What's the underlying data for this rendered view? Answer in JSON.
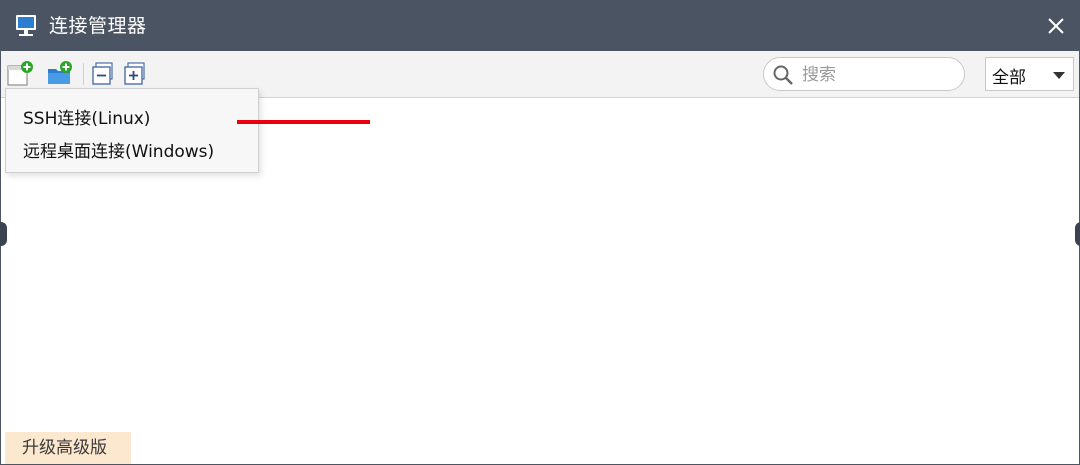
{
  "window": {
    "title": "连接管理器",
    "icon": "monitor-icon",
    "close_icon": "close-icon"
  },
  "toolbar": {
    "buttons": [
      {
        "name": "new-connection-icon"
      },
      {
        "name": "new-folder-icon"
      },
      {
        "name": "collapse-all-icon"
      },
      {
        "name": "expand-all-icon"
      }
    ],
    "search": {
      "placeholder": "搜索",
      "value": ""
    },
    "filter": {
      "selected": "全部"
    }
  },
  "new_connection_menu": {
    "items": [
      {
        "label": "SSH连接(Linux)"
      },
      {
        "label": "远程桌面连接(Windows)"
      }
    ]
  },
  "annotation": {
    "color": "#e8000a"
  },
  "footer": {
    "upgrade_label": "升级高级版"
  },
  "colors": {
    "titlebar": "#4b5462",
    "toolbar": "#f3f3f3",
    "upgrade_bg": "#fbe8cf",
    "accent_green": "#2aa52a",
    "icon_blue": "#2a7fd0"
  }
}
